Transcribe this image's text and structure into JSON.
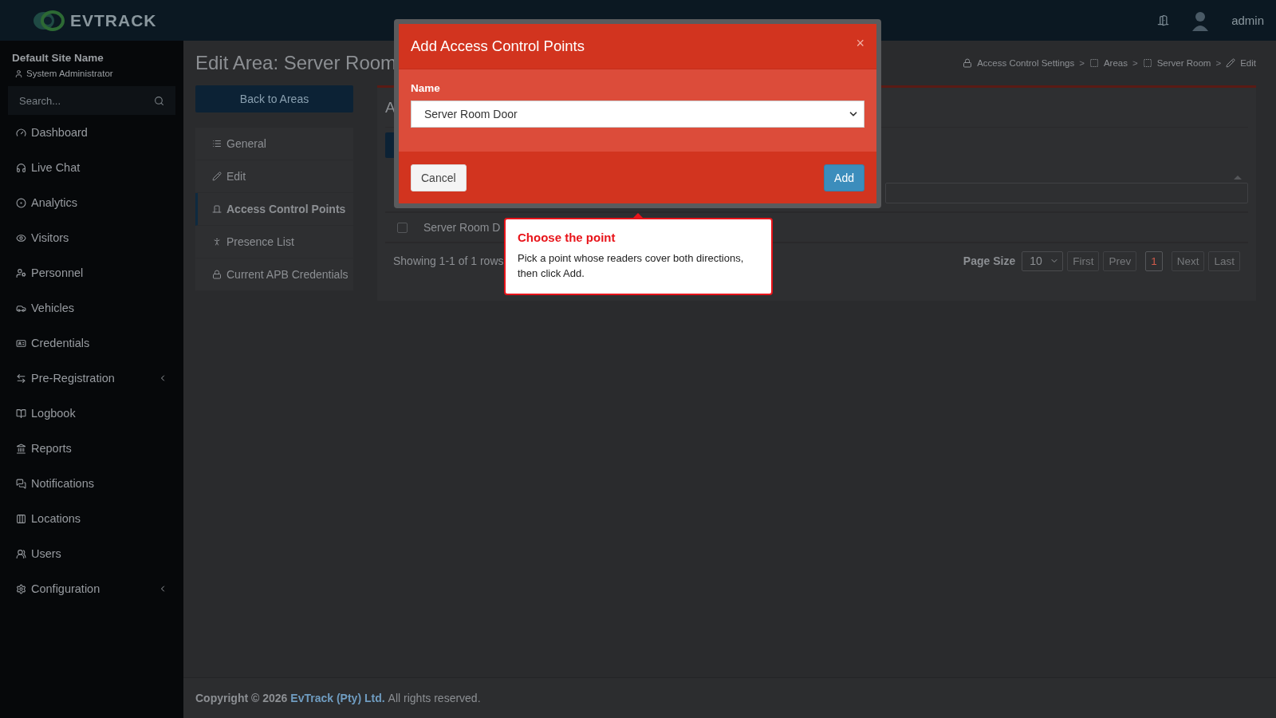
{
  "header": {
    "logo_text": "EVTRACK",
    "user": "admin"
  },
  "sidebar": {
    "site_name": "Default Site Name",
    "role": "System Administrator",
    "search": {
      "placeholder": "Search..."
    },
    "items": [
      {
        "label": "Dashboard",
        "expandable": false
      },
      {
        "label": "Live Chat",
        "expandable": false
      },
      {
        "label": "Analytics",
        "expandable": false
      },
      {
        "label": "Visitors",
        "expandable": false
      },
      {
        "label": "Personnel",
        "expandable": false
      },
      {
        "label": "Vehicles",
        "expandable": false
      },
      {
        "label": "Credentials",
        "expandable": false
      },
      {
        "label": "Pre-Registration",
        "expandable": true
      },
      {
        "label": "Logbook",
        "expandable": false
      },
      {
        "label": "Reports",
        "expandable": false
      },
      {
        "label": "Notifications",
        "expandable": false
      },
      {
        "label": "Locations",
        "expandable": false
      },
      {
        "label": "Users",
        "expandable": false
      },
      {
        "label": "Configuration",
        "expandable": true
      }
    ]
  },
  "page": {
    "title": "Edit Area: Server Room",
    "breadcrumbs": [
      {
        "label": "Access Control Settings",
        "separator": ">"
      },
      {
        "label": "Areas",
        "separator": ">"
      },
      {
        "label": "Server Room",
        "separator": ">"
      },
      {
        "label": "Edit"
      }
    ],
    "back_button": "Back to Areas",
    "nav": [
      {
        "label": "General",
        "selected": false
      },
      {
        "label": "Edit",
        "selected": false
      },
      {
        "label": "Access Control Points",
        "selected": true
      },
      {
        "label": "Presence List",
        "selected": false
      },
      {
        "label": "Current APB Credentials",
        "selected": false
      }
    ],
    "panel": {
      "title": "A",
      "rows": [
        {
          "checked": false,
          "name": "Server Room D"
        }
      ],
      "summary": "Showing 1-1 of 1 rows",
      "page_size_label": "Page Size",
      "page_size": "10",
      "pager": [
        {
          "label": "First",
          "selected": false,
          "disabled": true
        },
        {
          "label": "Prev",
          "selected": false,
          "disabled": true
        },
        {
          "label": "1",
          "selected": true,
          "disabled": false
        },
        {
          "label": "Next",
          "selected": false,
          "disabled": true
        },
        {
          "label": "Last",
          "selected": false,
          "disabled": true
        }
      ]
    }
  },
  "modal": {
    "title": "Add Access Control Points",
    "close": "×",
    "field_label": "Name",
    "field_value": "Server Room Door",
    "buttons": [
      {
        "label": "Cancel",
        "kind": "secondary"
      },
      {
        "label": "Add",
        "kind": "primary"
      }
    ]
  },
  "tooltip": {
    "title": "Choose the point",
    "text": "Pick a point whose readers cover both directions, then click Add."
  },
  "footer": {
    "prefix": "Copyright © 2026",
    "company": "EvTrack (Pty) Ltd.",
    "suffix": "All rights reserved."
  }
}
